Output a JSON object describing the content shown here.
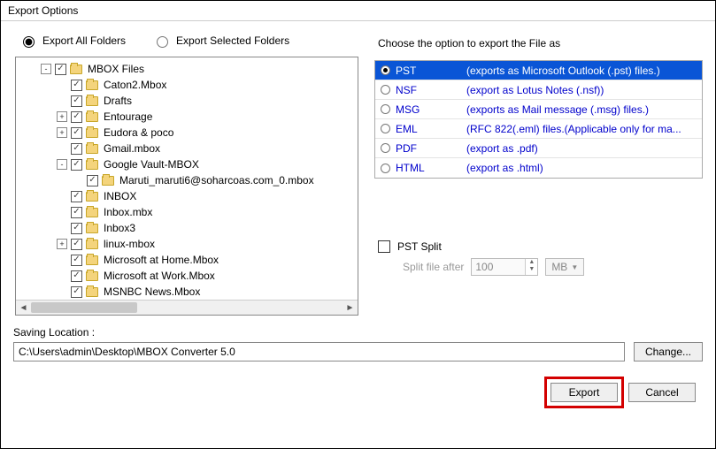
{
  "window": {
    "title": "Export Options"
  },
  "radios": {
    "all": "Export All Folders",
    "selected": "Export Selected Folders",
    "value": "all"
  },
  "tree": [
    {
      "indent": 0,
      "toggle": "-",
      "checked": true,
      "label": "MBOX Files"
    },
    {
      "indent": 1,
      "toggle": "",
      "checked": true,
      "label": "Caton2.Mbox"
    },
    {
      "indent": 1,
      "toggle": "",
      "checked": true,
      "label": "Drafts"
    },
    {
      "indent": 1,
      "toggle": "+",
      "checked": true,
      "label": "Entourage"
    },
    {
      "indent": 1,
      "toggle": "+",
      "checked": true,
      "label": "Eudora & poco"
    },
    {
      "indent": 1,
      "toggle": "",
      "checked": true,
      "label": "Gmail.mbox"
    },
    {
      "indent": 1,
      "toggle": "-",
      "checked": true,
      "label": "Google Vault-MBOX"
    },
    {
      "indent": 2,
      "toggle": "",
      "checked": true,
      "label": "Maruti_maruti6@soharcoas.com_0.mbox"
    },
    {
      "indent": 1,
      "toggle": "",
      "checked": true,
      "label": "INBOX"
    },
    {
      "indent": 1,
      "toggle": "",
      "checked": true,
      "label": "Inbox.mbx"
    },
    {
      "indent": 1,
      "toggle": "",
      "checked": true,
      "label": "Inbox3"
    },
    {
      "indent": 1,
      "toggle": "+",
      "checked": true,
      "label": "linux-mbox"
    },
    {
      "indent": 1,
      "toggle": "",
      "checked": true,
      "label": "Microsoft at Home.Mbox"
    },
    {
      "indent": 1,
      "toggle": "",
      "checked": true,
      "label": "Microsoft at Work.Mbox"
    },
    {
      "indent": 1,
      "toggle": "",
      "checked": true,
      "label": "MSNBC News.Mbox"
    }
  ],
  "format_title": "Choose the option to export the File as",
  "formats": [
    {
      "name": "PST",
      "desc": "(exports as Microsoft Outlook (.pst) files.)",
      "selected": true
    },
    {
      "name": "NSF",
      "desc": "(export as Lotus Notes (.nsf))",
      "selected": false
    },
    {
      "name": "MSG",
      "desc": "(exports as Mail message (.msg) files.)",
      "selected": false
    },
    {
      "name": "EML",
      "desc": "(RFC 822(.eml) files.(Applicable only for ma...",
      "selected": false
    },
    {
      "name": "PDF",
      "desc": "(export as .pdf)",
      "selected": false
    },
    {
      "name": "HTML",
      "desc": "(export as .html)",
      "selected": false
    }
  ],
  "pst_split": {
    "label": "PST Split",
    "checked": false,
    "split_label": "Split file after",
    "value": "100",
    "unit": "MB"
  },
  "saving": {
    "label": "Saving Location :",
    "path": "C:\\Users\\admin\\Desktop\\MBOX Converter 5.0",
    "change": "Change..."
  },
  "buttons": {
    "export": "Export",
    "cancel": "Cancel"
  }
}
